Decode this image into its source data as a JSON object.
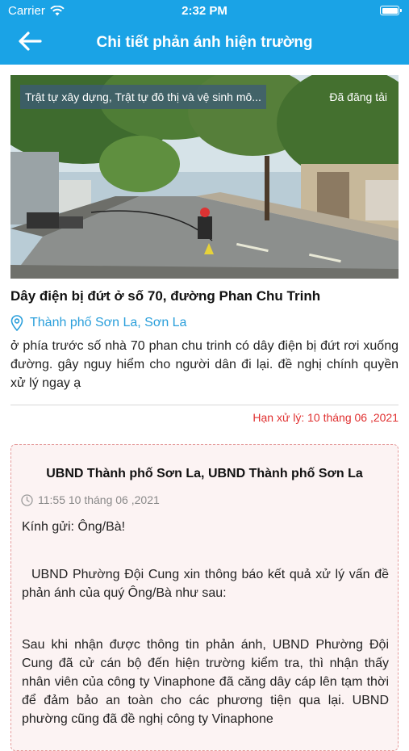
{
  "status_bar": {
    "carrier": "Carrier",
    "time": "2:32 PM"
  },
  "nav": {
    "title": "Chi tiết phản ánh hiện trường",
    "back_icon": "back-arrow-icon"
  },
  "report": {
    "category": "Trật tự xây dựng, Trật tự đô thị và vệ sinh mô...",
    "state": "Đã đăng tải",
    "title": "Dây điện bị đứt ở số 70, đường Phan Chu Trinh",
    "location": "Thành phố Sơn La, Sơn La",
    "description": "ở phía trước số nhà 70 phan chu trinh có dây điện bị đứt rơi xuống đường. gây nguy hiểm cho người dân đi lại. đề nghị chính quyền xử lý ngay ạ",
    "deadline": "Hạn xử lý: 10 tháng 06 ,2021"
  },
  "response": {
    "title": "UBND Thành phố Sơn La, UBND Thành phố Sơn La",
    "time": "11:55 10 tháng 06 ,2021",
    "greeting": "Kính gửi: Ông/Bà!",
    "intro": "UBND Phường Đội Cung xin thông báo kết quả xử lý vấn đề phản ánh của quý Ông/Bà như sau:",
    "body": "Sau khi nhận được thông tin phản ánh, UBND Phường Đội Cung đã cử cán bộ đến hiện trường kiểm tra, thì nhận thấy nhân viên của công ty Vinaphone đã căng dây cáp lên tạm thời để đảm bảo an toàn cho các phương tiện qua lại. UBND phường cũng đã đề nghị công ty Vinaphone"
  },
  "colors": {
    "header": "#1aa3e6",
    "link": "#2a9fdb",
    "deadline": "#e02f2f",
    "response_border": "#e59a9a"
  }
}
